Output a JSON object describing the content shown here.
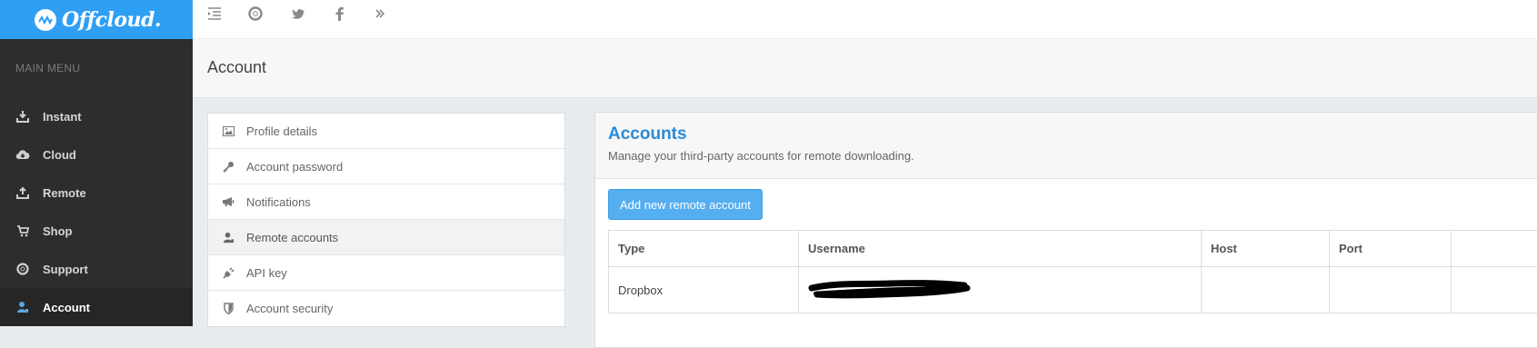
{
  "brand": {
    "name": "Offcloud."
  },
  "topbar": {
    "icons": [
      "menu-toggle-icon",
      "support-lifebuoy-icon",
      "twitter-icon",
      "facebook-icon",
      "double-chevron-right-icon"
    ]
  },
  "sidebar": {
    "menu_title": "MAIN MENU",
    "items": [
      {
        "label": "Instant",
        "icon": "download-tray-icon"
      },
      {
        "label": "Cloud",
        "icon": "cloud-download-icon"
      },
      {
        "label": "Remote",
        "icon": "upload-tray-icon"
      },
      {
        "label": "Shop",
        "icon": "cart-icon"
      },
      {
        "label": "Support",
        "icon": "lifebuoy-icon"
      },
      {
        "label": "Account",
        "icon": "user-icon",
        "active": true
      }
    ]
  },
  "page": {
    "title": "Account"
  },
  "settings_nav": {
    "items": [
      {
        "label": "Profile details",
        "icon": "picture-icon"
      },
      {
        "label": "Account password",
        "icon": "key-icon"
      },
      {
        "label": "Notifications",
        "icon": "megaphone-icon"
      },
      {
        "label": "Remote accounts",
        "icon": "user-icon",
        "active": true
      },
      {
        "label": "API key",
        "icon": "plug-icon"
      },
      {
        "label": "Account security",
        "icon": "shield-icon"
      }
    ]
  },
  "accounts_panel": {
    "title": "Accounts",
    "subtitle": "Manage your third-party accounts for remote downloading.",
    "add_button": "Add new remote account",
    "table": {
      "headers": [
        "Type",
        "Username",
        "Host",
        "Port",
        ""
      ],
      "rows": [
        {
          "type": "Dropbox",
          "username_redacted": true,
          "host": "",
          "port": ""
        }
      ]
    }
  },
  "colors": {
    "brand_blue": "#2f9ff3",
    "sidebar_bg": "#2d2d2d",
    "title_blue": "#2a8ad6",
    "button_blue": "#55aef0",
    "active_icon": "#5aa8e6"
  }
}
